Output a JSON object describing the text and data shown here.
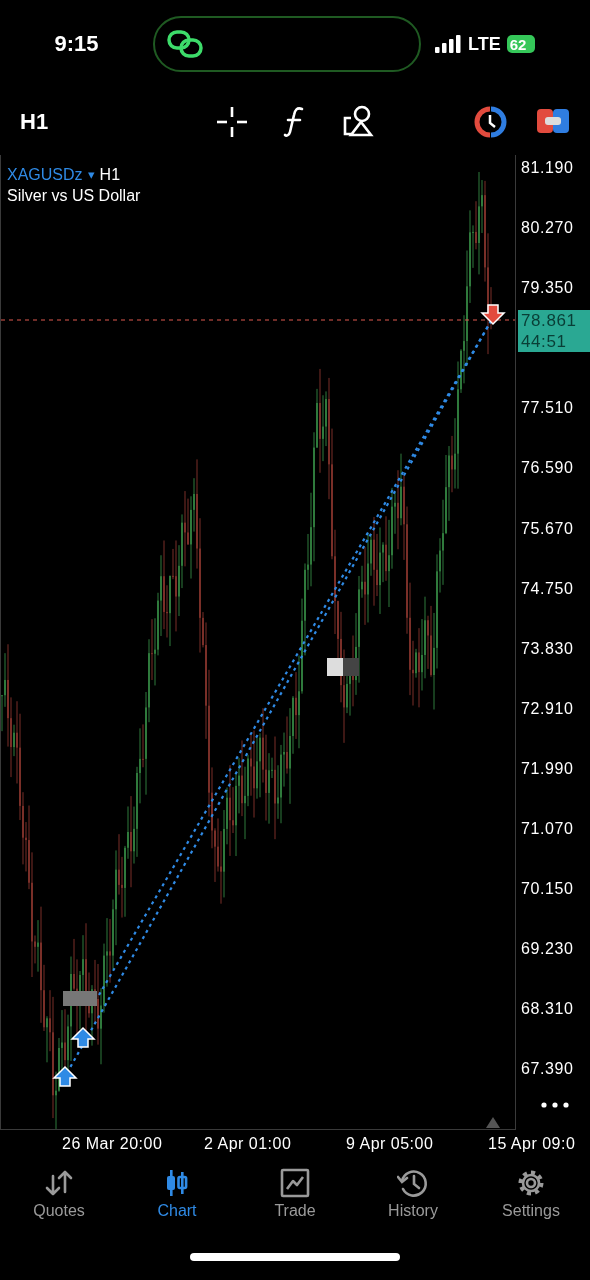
{
  "status_bar": {
    "time": "9:15",
    "network": "LTE",
    "battery": "62"
  },
  "toolbar": {
    "timeframe": "H1"
  },
  "chart": {
    "symbol": "XAGUSDz",
    "symbol_caret": "▾",
    "timeframe": "H1",
    "description": "Silver vs US Dollar",
    "price_axis": [
      "81.190",
      "80.270",
      "79.350",
      "77.510",
      "76.590",
      "75.670",
      "74.750",
      "73.830",
      "72.910",
      "71.990",
      "71.070",
      "70.150",
      "69.230",
      "68.310",
      "67.390"
    ],
    "current_price": "78.861",
    "countdown": "44:51",
    "time_axis": [
      "26 Mar 20:00",
      "2 Apr 01:00",
      "9 Apr 05:00",
      "15 Apr 09:0"
    ]
  },
  "tabs": [
    {
      "label": "Quotes",
      "selected": false
    },
    {
      "label": "Chart",
      "selected": true
    },
    {
      "label": "Trade",
      "selected": false
    },
    {
      "label": "History",
      "selected": false
    },
    {
      "label": "Settings",
      "selected": false
    }
  ]
}
